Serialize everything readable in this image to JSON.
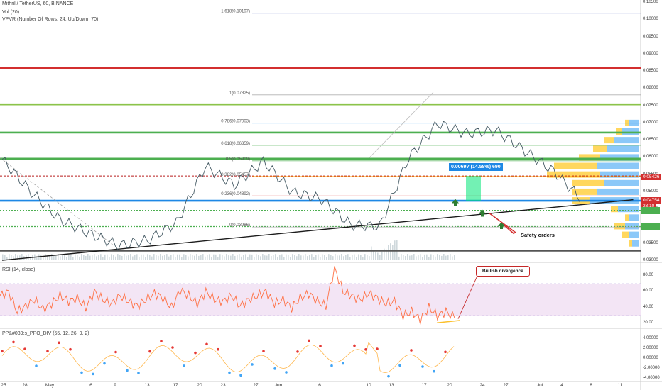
{
  "header": {
    "symbol_line": "Mithril / TetherUS, 60, BINANCE",
    "vol_label": "Vol (20)",
    "vpvr_label": "VPVR (Number Of Rows, 24, Up/Down, 70)"
  },
  "rsi_panel": {
    "label": "RSI (14, close)",
    "levels": [
      80,
      70,
      50,
      30,
      20
    ]
  },
  "ppo_panel": {
    "label": "PP&#039;s_PPO_DIV (55, 12, 26, 9, 2)"
  },
  "annotations": {
    "measure": "0.0069? (14.58%) 690",
    "safety_orders": "Safety orders",
    "bullish_divergence": "Bullish divergence"
  },
  "colors": {
    "red": "#d32f2f",
    "green": "#4caf50",
    "light_green": "#8bc34a",
    "blue": "#42a5f5",
    "orange": "#ff7043",
    "navy": "#3f51b5",
    "rsi_band": "#f3e5f5",
    "vp_up": "#64b5f6",
    "vp_down": "#ffca28"
  },
  "chart_data": {
    "type": "line",
    "title": "Mithril / TetherUS, 60, BINANCE",
    "x": [
      "Apr 25",
      "Apr 28",
      "May 1",
      "May 6",
      "May 9",
      "May 13",
      "May 17",
      "May 20",
      "May 23",
      "May 27",
      "Jun 1",
      "Jun 6",
      "Jun 10",
      "Jun 13",
      "Jun 17",
      "Jun 20",
      "Jun 24",
      "Jun 27",
      "Jul 1",
      "Jul 4",
      "Jul 8",
      "Jul 11"
    ],
    "x_ticks": [
      "25",
      "28",
      "May",
      "6",
      "9",
      "13",
      "17",
      "20",
      "23",
      "27",
      "Jun",
      "6",
      "10",
      "13",
      "17",
      "20",
      "24",
      "27",
      "Jul",
      "4",
      "8",
      "11"
    ],
    "price_series": [
      0.0595,
      0.05,
      0.042,
      0.038,
      0.0345,
      0.036,
      0.041,
      0.0575,
      0.052,
      0.059,
      0.05,
      0.048,
      0.0405,
      0.04,
      0.06,
      0.07,
      0.067,
      0.068,
      0.062,
      0.056,
      0.0475
    ],
    "ylim": [
      0.03,
      0.105
    ],
    "y_ticks": [
      0.105,
      0.1,
      0.095,
      0.09,
      0.085,
      0.08,
      0.075,
      0.07,
      0.065,
      0.06,
      0.055,
      0.05,
      0.045,
      0.04,
      0.035,
      0.03
    ],
    "y_tick_labels": [
      "0.10500",
      "0.10000",
      "0.09500",
      "0.09000",
      "0.08500",
      "0.08000",
      "0.07500",
      "0.07000",
      "0.06500",
      "0.06000",
      "0.05500",
      "0.05000",
      "0.04500",
      "0.04000",
      "0.03500",
      "0.03000"
    ],
    "fib_levels": [
      {
        "label": "1.618(0.10197)",
        "value": 0.10197,
        "color": "#3f51b5"
      },
      {
        "label": "1(0.07825)",
        "value": 0.07825,
        "color": "#9e9e9e"
      },
      {
        "label": "0.786(0.07003)",
        "value": 0.07003,
        "color": "#42a5f5"
      },
      {
        "label": "0.618(0.06359)",
        "value": 0.06359,
        "color": "#4caf50"
      },
      {
        "label": "0.5(0.05909)",
        "value": 0.05909,
        "color": "#4caf50"
      },
      {
        "label": "0.382(0.05457)",
        "value": 0.05457,
        "color": "#ff9800"
      },
      {
        "label": "0.236(0.04892)",
        "value": 0.04892,
        "color": "#e57373"
      },
      {
        "label": "0(0.03986)",
        "value": 0.03986,
        "color": "#9e9e9e"
      }
    ],
    "horizontal_levels": [
      {
        "value": 0.086,
        "color": "#d32f2f"
      },
      {
        "value": 0.0755,
        "color": "#8bc34a"
      },
      {
        "value": 0.0673,
        "color": "#4caf50"
      },
      {
        "value": 0.0597,
        "color": "#4caf50"
      },
      {
        "value": 0.0547,
        "color": "#b71c1c",
        "dashed": true
      },
      {
        "value": 0.0475,
        "color": "#1e88e5"
      },
      {
        "value": 0.0447,
        "color": "#4caf50",
        "dotted": true
      },
      {
        "value": 0.04,
        "color": "#4caf50",
        "dotted": true
      },
      {
        "value": 0.033,
        "color": "#555555"
      }
    ],
    "price_tags": [
      {
        "label": "0.05426",
        "value": 0.0543,
        "color": "#d32f2f"
      },
      {
        "label": "0.04754",
        "value": 0.0476,
        "color": "#d32f2f"
      },
      {
        "label": "23:10",
        "value": 0.0459,
        "color": "#d32f2f"
      }
    ],
    "trendline": {
      "from": [
        0,
        0.0302
      ],
      "to": [
        21,
        0.0478
      ]
    },
    "volume_profile": [
      {
        "value": 0.07,
        "up": 0.15,
        "down": 0.05
      },
      {
        "value": 0.0675,
        "up": 0.25,
        "down": 0.08
      },
      {
        "value": 0.065,
        "up": 0.35,
        "down": 0.15
      },
      {
        "value": 0.0625,
        "up": 0.45,
        "down": 0.2
      },
      {
        "value": 0.06,
        "up": 0.55,
        "down": 0.3
      },
      {
        "value": 0.0575,
        "up": 0.6,
        "down": 0.6
      },
      {
        "value": 0.055,
        "up": 0.55,
        "down": 0.75
      },
      {
        "value": 0.0525,
        "up": 0.5,
        "down": 0.45
      },
      {
        "value": 0.05,
        "up": 0.6,
        "down": 0.35
      },
      {
        "value": 0.0475,
        "up": 0.7,
        "down": 0.25
      },
      {
        "value": 0.045,
        "up": 0.3,
        "down": 0.1
      },
      {
        "value": 0.0425,
        "up": 0.15,
        "down": 0.05
      },
      {
        "value": 0.04,
        "up": 0.2,
        "down": 0.15
      },
      {
        "value": 0.0375,
        "up": 0.15,
        "down": 0.1
      },
      {
        "value": 0.035,
        "up": 0.1,
        "down": 0.05
      }
    ],
    "rsi": {
      "ylim": [
        15,
        95
      ],
      "ticks": [
        80,
        60,
        40,
        20
      ],
      "tick_labels": [
        "80.00",
        "60.00",
        "40.00",
        "20.00"
      ],
      "series": [
        55,
        60,
        35,
        42,
        50,
        38,
        45,
        55,
        48,
        52,
        40,
        60,
        50,
        45,
        55,
        48,
        42,
        50,
        58,
        52,
        40,
        62,
        55,
        45,
        60,
        50,
        48,
        55,
        42,
        50,
        55,
        60,
        45,
        50,
        40,
        52,
        58,
        48,
        42,
        90,
        60,
        55,
        50,
        58,
        52,
        45,
        48,
        30,
        35,
        25,
        40,
        30,
        35,
        27
      ]
    },
    "ppo": {
      "ylim": [
        -4.5,
        6
      ],
      "ticks": [
        4,
        2,
        0,
        -2,
        -4
      ],
      "tick_labels": [
        "4.00000",
        "2.00000",
        "0.00000",
        "-2.00000",
        "-4.00000"
      ]
    }
  }
}
